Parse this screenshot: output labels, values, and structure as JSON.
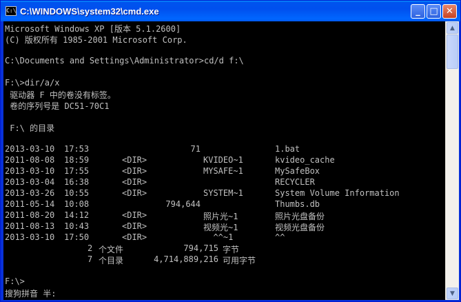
{
  "window": {
    "title": "C:\\WINDOWS\\system32\\cmd.exe",
    "icon_text": "C:\\",
    "controls": {
      "minimize": "_",
      "maximize": "□",
      "close": "✕"
    }
  },
  "console": {
    "header_lines": [
      "Microsoft Windows XP [版本 5.1.2600]",
      "(C) 版权所有 1985-2001 Microsoft Corp.",
      "",
      "C:\\Documents and Settings\\Administrator>cd/d f:\\",
      "",
      "F:\\>dir/a/x",
      " 驱动器 F 中的卷没有标签。",
      " 卷的序列号是 DC51-70C1",
      "",
      " F:\\ 的目录",
      ""
    ],
    "entries": [
      {
        "date": "2013-03-10",
        "time": "17:53",
        "dir": "",
        "size": "71",
        "short": "",
        "name": "1.bat"
      },
      {
        "date": "2011-08-08",
        "time": "18:59",
        "dir": "<DIR>",
        "size": "",
        "short": "KVIDEO~1",
        "name": "kvideo_cache"
      },
      {
        "date": "2013-03-10",
        "time": "17:55",
        "dir": "<DIR>",
        "size": "",
        "short": "MYSAFE~1",
        "name": "MySafeBox"
      },
      {
        "date": "2013-03-04",
        "time": "16:38",
        "dir": "<DIR>",
        "size": "",
        "short": "",
        "name": "RECYCLER"
      },
      {
        "date": "2013-03-26",
        "time": "10:55",
        "dir": "<DIR>",
        "size": "",
        "short": "SYSTEM~1",
        "name": "System Volume Information"
      },
      {
        "date": "2011-05-14",
        "time": "10:08",
        "dir": "",
        "size": "794,644",
        "short": "",
        "name": "Thumbs.db"
      },
      {
        "date": "2011-08-20",
        "time": "14:12",
        "dir": "<DIR>",
        "size": "",
        "short": "照片光~1",
        "name": "照片光盘备份"
      },
      {
        "date": "2011-08-13",
        "time": "10:43",
        "dir": "<DIR>",
        "size": "",
        "short": "视频光~1",
        "name": "视频光盘备份"
      },
      {
        "date": "2013-03-10",
        "time": "17:50",
        "dir": "<DIR>",
        "size": "",
        "short": "  ^^~1",
        "name": "^^"
      }
    ],
    "summary": [
      {
        "count": "2",
        "label": "个文件",
        "number": "794,715",
        "unit": "字节"
      },
      {
        "count": "7",
        "label": "个目录",
        "number": "4,714,889,216",
        "unit": "可用字节"
      }
    ],
    "footer_lines": [
      "",
      "F:\\>",
      "搜狗拼音 半:"
    ]
  },
  "scrollbar": {
    "up": "▲",
    "down": "▼"
  }
}
